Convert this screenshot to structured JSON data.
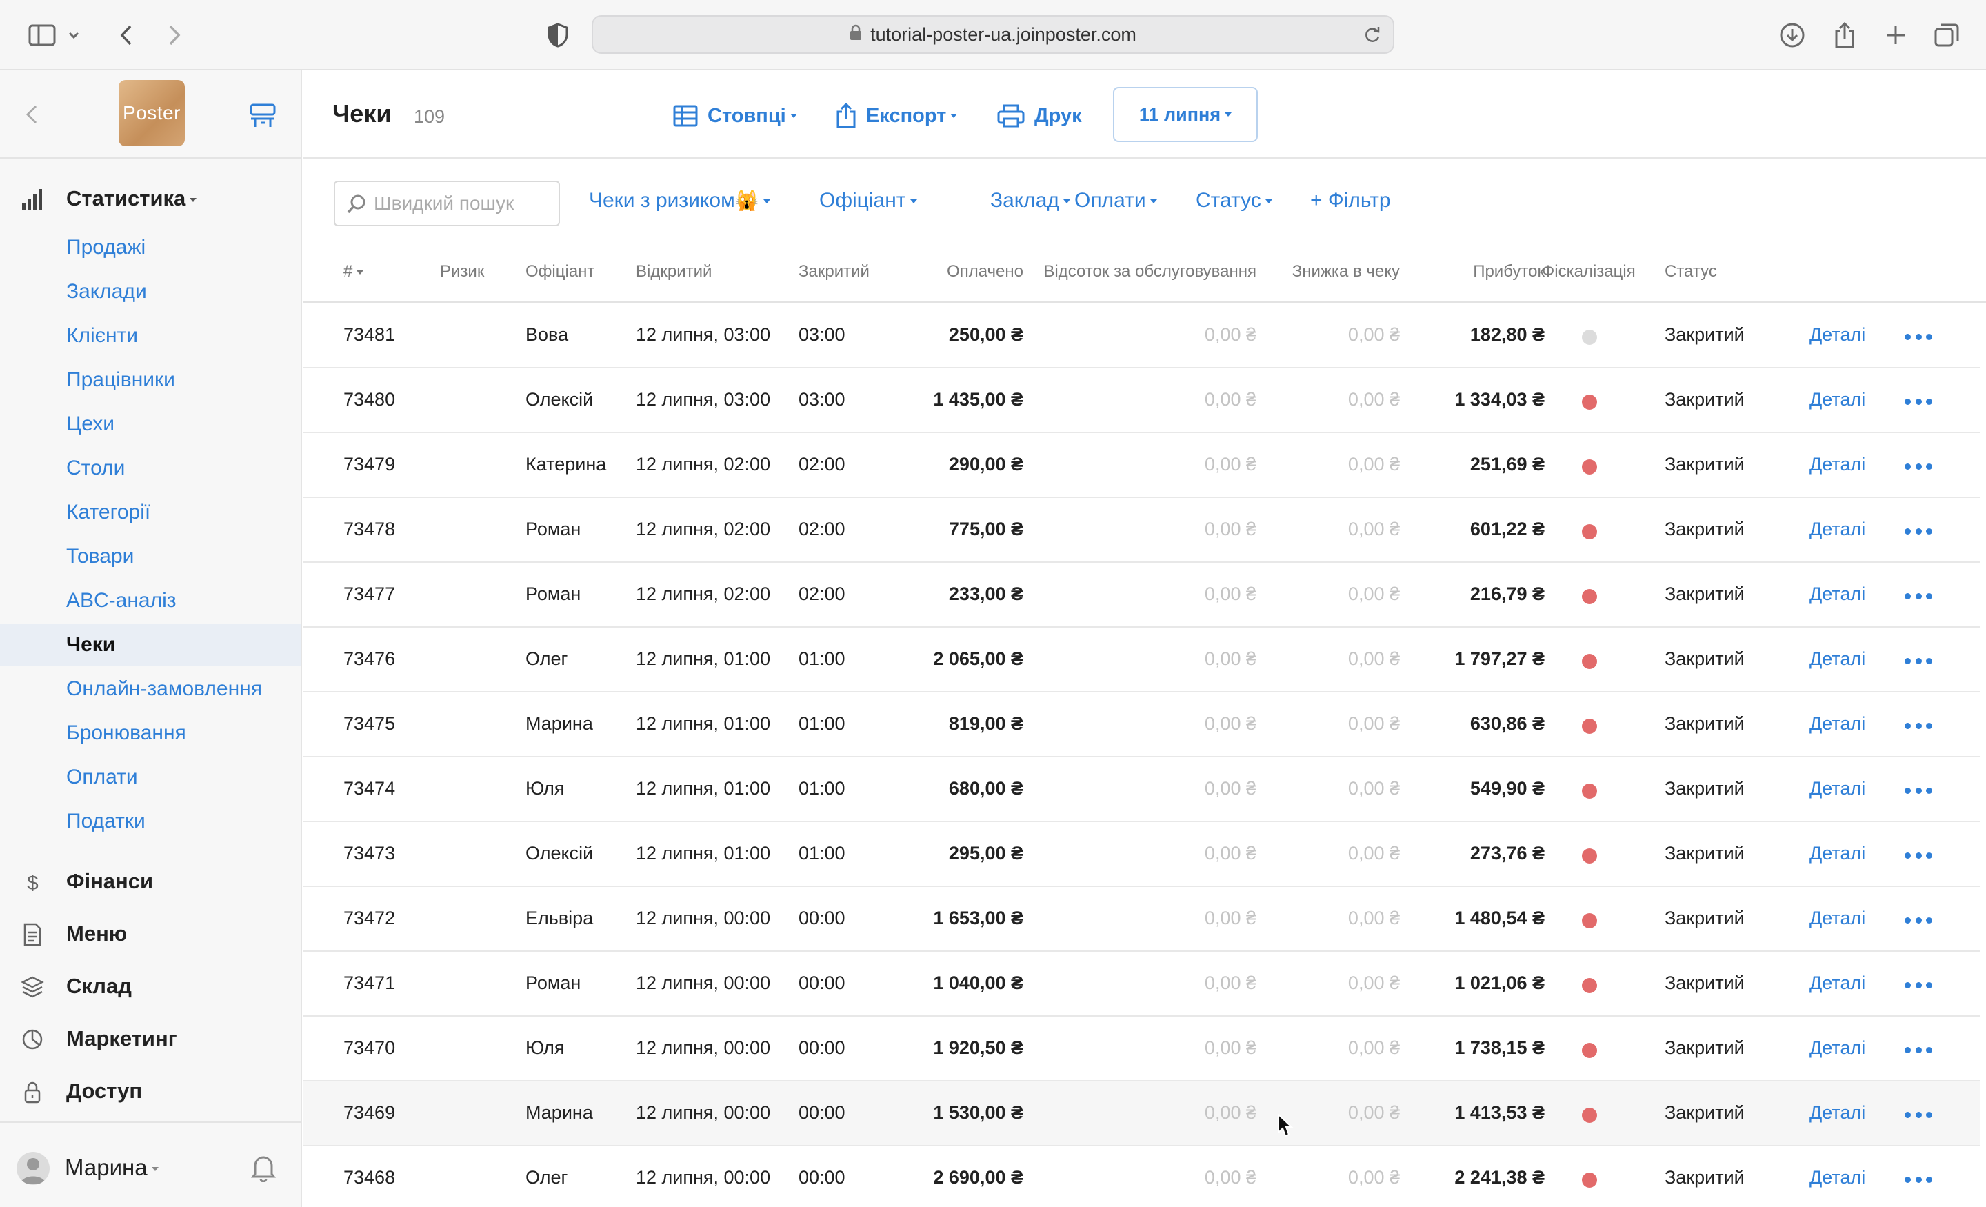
{
  "browser": {
    "url": "tutorial-poster-ua.joinposter.com"
  },
  "sidebar": {
    "logo_text": "Poster",
    "stats_label": "Статистика",
    "stats_items": [
      {
        "label": "Продажі"
      },
      {
        "label": "Заклади"
      },
      {
        "label": "Клієнти"
      },
      {
        "label": "Працівники"
      },
      {
        "label": "Цехи"
      },
      {
        "label": "Столи"
      },
      {
        "label": "Категорії"
      },
      {
        "label": "Товари"
      },
      {
        "label": "ABC-аналіз"
      },
      {
        "label": "Чеки",
        "active": true
      },
      {
        "label": "Онлайн-замовлення"
      },
      {
        "label": "Бронювання"
      },
      {
        "label": "Оплати"
      },
      {
        "label": "Податки"
      }
    ],
    "sections": [
      {
        "label": "Фінанси",
        "icon": "dollar-icon"
      },
      {
        "label": "Меню",
        "icon": "document-icon"
      },
      {
        "label": "Склад",
        "icon": "layers-icon"
      },
      {
        "label": "Маркетинг",
        "icon": "pie-icon"
      },
      {
        "label": "Доступ",
        "icon": "lock-icon"
      }
    ],
    "user_name": "Марина"
  },
  "header": {
    "title": "Чеки",
    "count": "109",
    "columns_label": "Стовпці",
    "export_label": "Експорт",
    "print_label": "Друк",
    "date_label": "11 липня"
  },
  "filters": {
    "search_placeholder": "Швидкий пошук",
    "risk_label": "Чеки з ризиком",
    "risk_emoji": "🙀",
    "waiter_label": "Офіціант",
    "place_label": "Заклад",
    "payments_label": "Оплати",
    "status_label": "Статус",
    "add_filter_label": "+ Фільтр"
  },
  "table": {
    "columns": {
      "num": "#",
      "risk": "Ризик",
      "waiter": "Офіціант",
      "opened": "Відкритий",
      "closed": "Закритий",
      "paid": "Оплачено",
      "service": "Відсоток за обслуговування",
      "discount": "Знижка в чеку",
      "profit": "Прибуток",
      "fiscal": "Фіскалізація",
      "status": "Статус"
    },
    "details_label": "Деталі",
    "colors": {
      "fiscal_red": "#e26a6a",
      "fiscal_grey": "#dcdcdc",
      "link": "#2f7fd7"
    },
    "rows": [
      {
        "num": "73481",
        "waiter": "Вова",
        "opened": "12 липня, 03:00",
        "closed": "03:00",
        "paid": "250,00 ₴",
        "service": "0,00 ₴",
        "discount": "0,00 ₴",
        "profit": "182,80 ₴",
        "fiscal": "grey",
        "status": "Закритий"
      },
      {
        "num": "73480",
        "waiter": "Олексій",
        "opened": "12 липня, 03:00",
        "closed": "03:00",
        "paid": "1 435,00 ₴",
        "service": "0,00 ₴",
        "discount": "0,00 ₴",
        "profit": "1 334,03 ₴",
        "fiscal": "red",
        "status": "Закритий"
      },
      {
        "num": "73479",
        "waiter": "Катерина",
        "opened": "12 липня, 02:00",
        "closed": "02:00",
        "paid": "290,00 ₴",
        "service": "0,00 ₴",
        "discount": "0,00 ₴",
        "profit": "251,69 ₴",
        "fiscal": "red",
        "status": "Закритий"
      },
      {
        "num": "73478",
        "waiter": "Роман",
        "opened": "12 липня, 02:00",
        "closed": "02:00",
        "paid": "775,00 ₴",
        "service": "0,00 ₴",
        "discount": "0,00 ₴",
        "profit": "601,22 ₴",
        "fiscal": "red",
        "status": "Закритий"
      },
      {
        "num": "73477",
        "waiter": "Роман",
        "opened": "12 липня, 02:00",
        "closed": "02:00",
        "paid": "233,00 ₴",
        "service": "0,00 ₴",
        "discount": "0,00 ₴",
        "profit": "216,79 ₴",
        "fiscal": "red",
        "status": "Закритий"
      },
      {
        "num": "73476",
        "waiter": "Олег",
        "opened": "12 липня, 01:00",
        "closed": "01:00",
        "paid": "2 065,00 ₴",
        "service": "0,00 ₴",
        "discount": "0,00 ₴",
        "profit": "1 797,27 ₴",
        "fiscal": "red",
        "status": "Закритий"
      },
      {
        "num": "73475",
        "waiter": "Марина",
        "opened": "12 липня, 01:00",
        "closed": "01:00",
        "paid": "819,00 ₴",
        "service": "0,00 ₴",
        "discount": "0,00 ₴",
        "profit": "630,86 ₴",
        "fiscal": "red",
        "status": "Закритий"
      },
      {
        "num": "73474",
        "waiter": "Юля",
        "opened": "12 липня, 01:00",
        "closed": "01:00",
        "paid": "680,00 ₴",
        "service": "0,00 ₴",
        "discount": "0,00 ₴",
        "profit": "549,90 ₴",
        "fiscal": "red",
        "status": "Закритий"
      },
      {
        "num": "73473",
        "waiter": "Олексій",
        "opened": "12 липня, 01:00",
        "closed": "01:00",
        "paid": "295,00 ₴",
        "service": "0,00 ₴",
        "discount": "0,00 ₴",
        "profit": "273,76 ₴",
        "fiscal": "red",
        "status": "Закритий"
      },
      {
        "num": "73472",
        "waiter": "Ельвіра",
        "opened": "12 липня, 00:00",
        "closed": "00:00",
        "paid": "1 653,00 ₴",
        "service": "0,00 ₴",
        "discount": "0,00 ₴",
        "profit": "1 480,54 ₴",
        "fiscal": "red",
        "status": "Закритий"
      },
      {
        "num": "73471",
        "waiter": "Роман",
        "opened": "12 липня, 00:00",
        "closed": "00:00",
        "paid": "1 040,00 ₴",
        "service": "0,00 ₴",
        "discount": "0,00 ₴",
        "profit": "1 021,06 ₴",
        "fiscal": "red",
        "status": "Закритий"
      },
      {
        "num": "73470",
        "waiter": "Юля",
        "opened": "12 липня, 00:00",
        "closed": "00:00",
        "paid": "1 920,50 ₴",
        "service": "0,00 ₴",
        "discount": "0,00 ₴",
        "profit": "1 738,15 ₴",
        "fiscal": "red",
        "status": "Закритий"
      },
      {
        "num": "73469",
        "waiter": "Марина",
        "opened": "12 липня, 00:00",
        "closed": "00:00",
        "paid": "1 530,00 ₴",
        "service": "0,00 ₴",
        "discount": "0,00 ₴",
        "profit": "1 413,53 ₴",
        "fiscal": "red",
        "status": "Закритий",
        "hover": true
      },
      {
        "num": "73468",
        "waiter": "Олег",
        "opened": "12 липня, 00:00",
        "closed": "00:00",
        "paid": "2 690,00 ₴",
        "service": "0,00 ₴",
        "discount": "0,00 ₴",
        "profit": "2 241,38 ₴",
        "fiscal": "red",
        "status": "Закритий"
      }
    ]
  }
}
